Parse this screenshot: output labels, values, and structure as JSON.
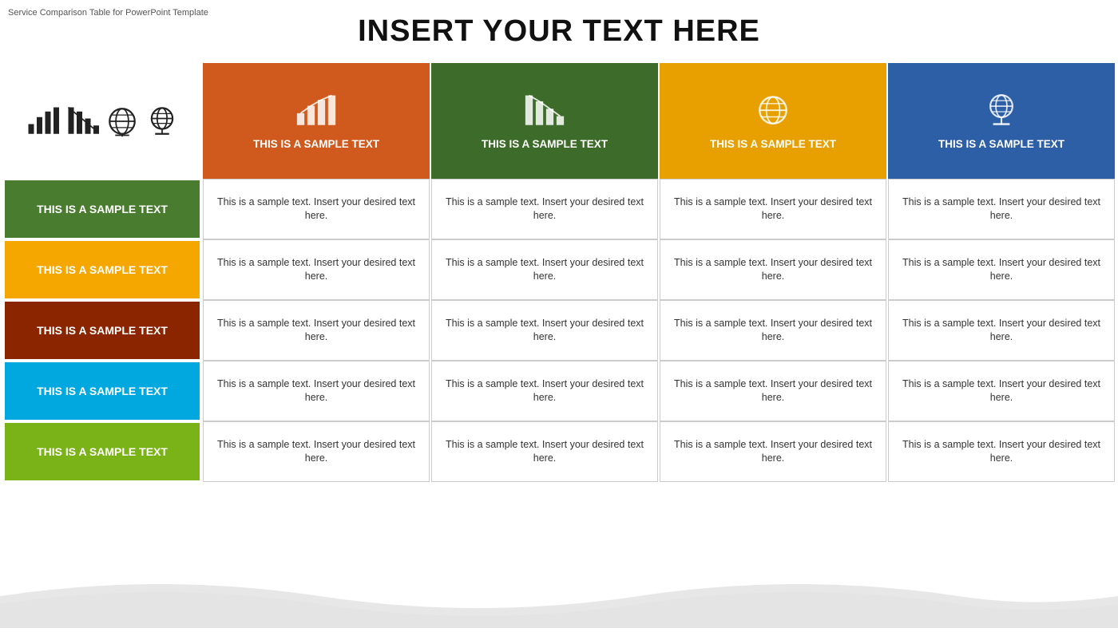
{
  "watermark": "Service Comparison Table for PowerPoint Template",
  "title": "INSERT YOUR TEXT HERE",
  "columns": [
    {
      "id": "col1",
      "colorClass": "col-orange",
      "header_text": "THIS IS A SAMPLE TEXT",
      "icon": "bar-up"
    },
    {
      "id": "col2",
      "colorClass": "col-dkgreen",
      "header_text": "THIS IS A SAMPLE TEXT",
      "icon": "bar-down"
    },
    {
      "id": "col3",
      "colorClass": "col-amber",
      "header_text": "THIS IS A SAMPLE TEXT",
      "icon": "globe"
    },
    {
      "id": "col4",
      "colorClass": "col-blue",
      "header_text": "THIS IS A SAMPLE TEXT",
      "icon": "globe-stand"
    }
  ],
  "rows": [
    {
      "label": "THIS IS A SAMPLE TEXT",
      "labelClass": "row-label-green",
      "cell_text": "This is a sample text. Insert your desired text here."
    },
    {
      "label": "THIS IS A SAMPLE TEXT",
      "labelClass": "row-label-yellow",
      "cell_text": "This is a sample text. Insert your desired text here."
    },
    {
      "label": "THIS IS A SAMPLE TEXT",
      "labelClass": "row-label-brown",
      "cell_text": "This is a sample text. Insert your desired text here."
    },
    {
      "label": "THIS IS A SAMPLE TEXT",
      "labelClass": "row-label-cyan",
      "cell_text": "This is a sample text. Insert your desired text here."
    },
    {
      "label": "THIS IS A SAMPLE TEXT",
      "labelClass": "row-label-lime",
      "cell_text": "This is a sample text. Insert your desired text here."
    }
  ],
  "icons": {
    "bar-chart": "📊",
    "globe": "🌐"
  }
}
